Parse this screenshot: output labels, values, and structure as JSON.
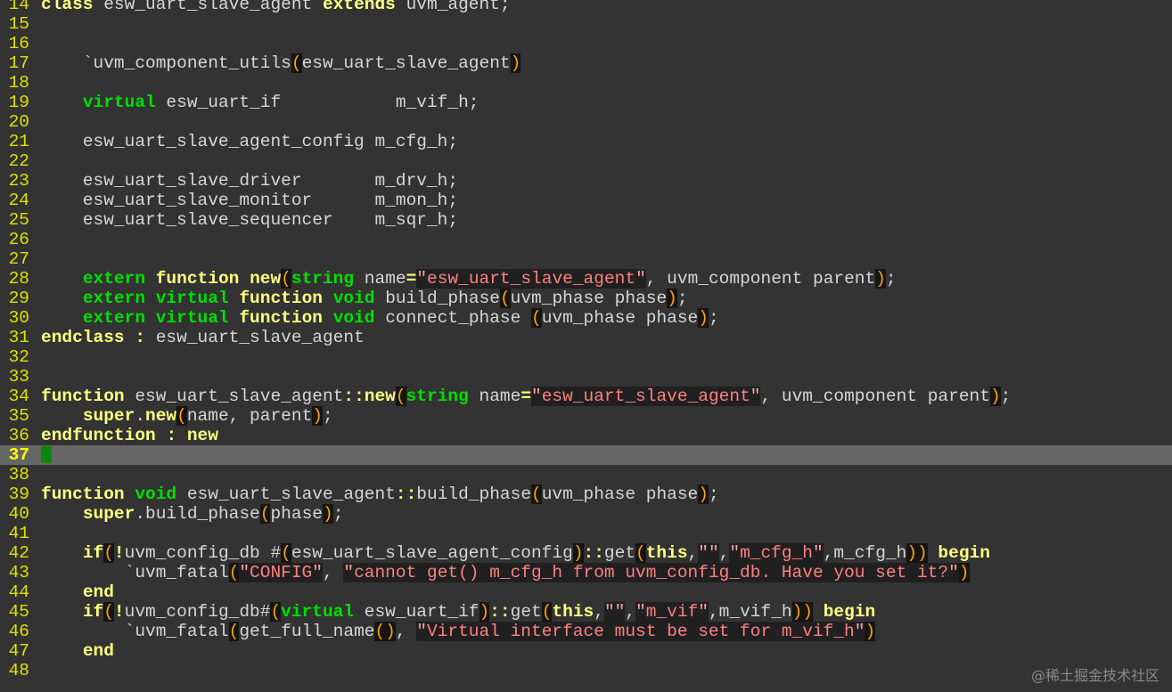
{
  "editor": {
    "lines": [
      {
        "n": "14",
        "cursor": false,
        "tokens": [
          [
            "kwy",
            "class"
          ],
          [
            "pl",
            " esw_uart_slave_agent "
          ],
          [
            "kwy",
            "extends"
          ],
          [
            "pl",
            " uvm_agent;"
          ]
        ]
      },
      {
        "n": "15",
        "cursor": false,
        "tokens": []
      },
      {
        "n": "16",
        "cursor": false,
        "tokens": []
      },
      {
        "n": "17",
        "cursor": false,
        "tokens": [
          [
            "pl",
            "    `uvm_component_utils"
          ],
          [
            "par",
            "("
          ],
          [
            "pl",
            "esw_uart_slave_agent"
          ],
          [
            "par",
            ")"
          ]
        ]
      },
      {
        "n": "18",
        "cursor": false,
        "tokens": []
      },
      {
        "n": "19",
        "cursor": false,
        "tokens": [
          [
            "pl",
            "    "
          ],
          [
            "kw",
            "virtual"
          ],
          [
            "pl",
            " esw_uart_if           m_vif_h;"
          ]
        ]
      },
      {
        "n": "20",
        "cursor": false,
        "tokens": []
      },
      {
        "n": "21",
        "cursor": false,
        "tokens": [
          [
            "pl",
            "    esw_uart_slave_agent_config m_cfg_h;"
          ]
        ]
      },
      {
        "n": "22",
        "cursor": false,
        "tokens": []
      },
      {
        "n": "23",
        "cursor": false,
        "tokens": [
          [
            "pl",
            "    esw_uart_slave_driver       m_drv_h;"
          ]
        ]
      },
      {
        "n": "24",
        "cursor": false,
        "tokens": [
          [
            "pl",
            "    esw_uart_slave_monitor      m_mon_h;"
          ]
        ]
      },
      {
        "n": "25",
        "cursor": false,
        "tokens": [
          [
            "pl",
            "    esw_uart_slave_sequencer    m_sqr_h;"
          ]
        ]
      },
      {
        "n": "26",
        "cursor": false,
        "tokens": []
      },
      {
        "n": "27",
        "cursor": false,
        "tokens": []
      },
      {
        "n": "28",
        "cursor": false,
        "tokens": [
          [
            "pl",
            "    "
          ],
          [
            "kw",
            "extern"
          ],
          [
            "pl",
            " "
          ],
          [
            "kwy",
            "function"
          ],
          [
            "pl",
            " "
          ],
          [
            "kwy",
            "new"
          ],
          [
            "par",
            "("
          ],
          [
            "kw",
            "string"
          ],
          [
            "pl",
            " name"
          ],
          [
            "ex",
            "="
          ],
          [
            "dq",
            "\""
          ],
          [
            "str",
            "esw_uart_slave_agent"
          ],
          [
            "dq",
            "\""
          ],
          [
            "pl",
            ", uvm_component parent"
          ],
          [
            "par",
            ")"
          ],
          [
            "pl",
            ";"
          ]
        ]
      },
      {
        "n": "29",
        "cursor": false,
        "tokens": [
          [
            "pl",
            "    "
          ],
          [
            "kw",
            "extern"
          ],
          [
            "pl",
            " "
          ],
          [
            "kw",
            "virtual"
          ],
          [
            "pl",
            " "
          ],
          [
            "kwy",
            "function"
          ],
          [
            "pl",
            " "
          ],
          [
            "kw",
            "void"
          ],
          [
            "pl",
            " build_phase"
          ],
          [
            "par",
            "("
          ],
          [
            "pl",
            "uvm_phase phase"
          ],
          [
            "par",
            ")"
          ],
          [
            "pl",
            ";"
          ]
        ]
      },
      {
        "n": "30",
        "cursor": false,
        "tokens": [
          [
            "pl",
            "    "
          ],
          [
            "kw",
            "extern"
          ],
          [
            "pl",
            " "
          ],
          [
            "kw",
            "virtual"
          ],
          [
            "pl",
            " "
          ],
          [
            "kwy",
            "function"
          ],
          [
            "pl",
            " "
          ],
          [
            "kw",
            "void"
          ],
          [
            "pl",
            " connect_phase "
          ],
          [
            "par",
            "("
          ],
          [
            "pl",
            "uvm_phase phase"
          ],
          [
            "par",
            ")"
          ],
          [
            "pl",
            ";"
          ]
        ]
      },
      {
        "n": "31",
        "cursor": false,
        "tokens": [
          [
            "kwy",
            "endclass"
          ],
          [
            "pl",
            " "
          ],
          [
            "ex",
            ":"
          ],
          [
            "pl",
            " esw_uart_slave_agent"
          ]
        ]
      },
      {
        "n": "32",
        "cursor": false,
        "tokens": []
      },
      {
        "n": "33",
        "cursor": false,
        "tokens": []
      },
      {
        "n": "34",
        "cursor": false,
        "tokens": [
          [
            "kwy",
            "function"
          ],
          [
            "pl",
            " esw_uart_slave_agent"
          ],
          [
            "ex",
            "::"
          ],
          [
            "kwy",
            "new"
          ],
          [
            "par",
            "("
          ],
          [
            "kw",
            "string"
          ],
          [
            "pl",
            " name"
          ],
          [
            "ex",
            "="
          ],
          [
            "dq",
            "\""
          ],
          [
            "str",
            "esw_uart_slave_agent"
          ],
          [
            "dq",
            "\""
          ],
          [
            "pl",
            ", uvm_component parent"
          ],
          [
            "par",
            ")"
          ],
          [
            "pl",
            ";"
          ]
        ]
      },
      {
        "n": "35",
        "cursor": false,
        "tokens": [
          [
            "pl",
            "    "
          ],
          [
            "kwy",
            "super"
          ],
          [
            "pl",
            "."
          ],
          [
            "kwy",
            "new"
          ],
          [
            "par",
            "("
          ],
          [
            "pl",
            "name, parent"
          ],
          [
            "par",
            ")"
          ],
          [
            "pl",
            ";"
          ]
        ]
      },
      {
        "n": "36",
        "cursor": false,
        "tokens": [
          [
            "kwy",
            "endfunction"
          ],
          [
            "pl",
            " "
          ],
          [
            "ex",
            ":"
          ],
          [
            "pl",
            " "
          ],
          [
            "kwy",
            "new"
          ]
        ]
      },
      {
        "n": "37",
        "cursor": true,
        "tokens": []
      },
      {
        "n": "38",
        "cursor": false,
        "tokens": []
      },
      {
        "n": "39",
        "cursor": false,
        "tokens": [
          [
            "kwy",
            "function"
          ],
          [
            "pl",
            " "
          ],
          [
            "kw",
            "void"
          ],
          [
            "pl",
            " esw_uart_slave_agent"
          ],
          [
            "ex",
            "::"
          ],
          [
            "pl",
            "build_phase"
          ],
          [
            "par",
            "("
          ],
          [
            "pl",
            "uvm_phase phase"
          ],
          [
            "par",
            ")"
          ],
          [
            "pl",
            ";"
          ]
        ]
      },
      {
        "n": "40",
        "cursor": false,
        "tokens": [
          [
            "pl",
            "    "
          ],
          [
            "kwy",
            "super"
          ],
          [
            "pl",
            ".build_phase"
          ],
          [
            "par",
            "("
          ],
          [
            "pl",
            "phase"
          ],
          [
            "par",
            ")"
          ],
          [
            "pl",
            ";"
          ]
        ]
      },
      {
        "n": "41",
        "cursor": false,
        "tokens": []
      },
      {
        "n": "42",
        "cursor": false,
        "tokens": [
          [
            "pl",
            "    "
          ],
          [
            "kwy",
            "if"
          ],
          [
            "par",
            "("
          ],
          [
            "ex",
            "!"
          ],
          [
            "pl",
            "uvm_config_db #"
          ],
          [
            "par",
            "("
          ],
          [
            "pl",
            "esw_uart_slave_agent_config"
          ],
          [
            "par",
            ")"
          ],
          [
            "ex",
            "::"
          ],
          [
            "pl",
            "get"
          ],
          [
            "par",
            "("
          ],
          [
            "kwy",
            "this"
          ],
          [
            "pl",
            ","
          ],
          [
            "dq",
            "\"\""
          ],
          [
            "pl",
            ","
          ],
          [
            "dq",
            "\""
          ],
          [
            "str",
            "m_cfg_h"
          ],
          [
            "dq",
            "\""
          ],
          [
            "pl",
            ",m_cfg_h"
          ],
          [
            "par",
            "))"
          ],
          [
            "pl",
            " "
          ],
          [
            "kwy",
            "begin"
          ]
        ]
      },
      {
        "n": "43",
        "cursor": false,
        "tokens": [
          [
            "pl",
            "        `uvm_fatal"
          ],
          [
            "par",
            "("
          ],
          [
            "dq",
            "\""
          ],
          [
            "str",
            "CONFIG"
          ],
          [
            "dq",
            "\""
          ],
          [
            "pl",
            ", "
          ],
          [
            "dq",
            "\""
          ],
          [
            "str",
            "cannot get() m_cfg_h from uvm_config_db. Have you set it?"
          ],
          [
            "dq",
            "\""
          ],
          [
            "par",
            ")"
          ]
        ]
      },
      {
        "n": "44",
        "cursor": false,
        "tokens": [
          [
            "pl",
            "    "
          ],
          [
            "kwy",
            "end"
          ]
        ]
      },
      {
        "n": "45",
        "cursor": false,
        "tokens": [
          [
            "pl",
            "    "
          ],
          [
            "kwy",
            "if"
          ],
          [
            "par",
            "("
          ],
          [
            "ex",
            "!"
          ],
          [
            "pl",
            "uvm_config_db#"
          ],
          [
            "par",
            "("
          ],
          [
            "kw",
            "virtual"
          ],
          [
            "pl",
            " esw_uart_if"
          ],
          [
            "par",
            ")"
          ],
          [
            "ex",
            "::"
          ],
          [
            "pl",
            "get"
          ],
          [
            "par",
            "("
          ],
          [
            "kwy",
            "this"
          ],
          [
            "pl",
            ","
          ],
          [
            "dq",
            "\"\""
          ],
          [
            "pl",
            ","
          ],
          [
            "dq",
            "\""
          ],
          [
            "str",
            "m_vif"
          ],
          [
            "dq",
            "\""
          ],
          [
            "pl",
            ",m_vif_h"
          ],
          [
            "par",
            "))"
          ],
          [
            "pl",
            " "
          ],
          [
            "kwy",
            "begin"
          ]
        ]
      },
      {
        "n": "46",
        "cursor": false,
        "tokens": [
          [
            "pl",
            "        `uvm_fatal"
          ],
          [
            "par",
            "("
          ],
          [
            "pl",
            "get_full_name"
          ],
          [
            "par",
            "()"
          ],
          [
            "pl",
            ", "
          ],
          [
            "dq",
            "\""
          ],
          [
            "str",
            "Virtual interface must be set for m_vif_h"
          ],
          [
            "dq",
            "\""
          ],
          [
            "par",
            ")"
          ]
        ]
      },
      {
        "n": "47",
        "cursor": false,
        "tokens": [
          [
            "pl",
            "    "
          ],
          [
            "kwy",
            "end"
          ]
        ]
      },
      {
        "n": "48",
        "cursor": false,
        "tokens": []
      }
    ]
  },
  "watermark": "@稀土掘金技术社区"
}
